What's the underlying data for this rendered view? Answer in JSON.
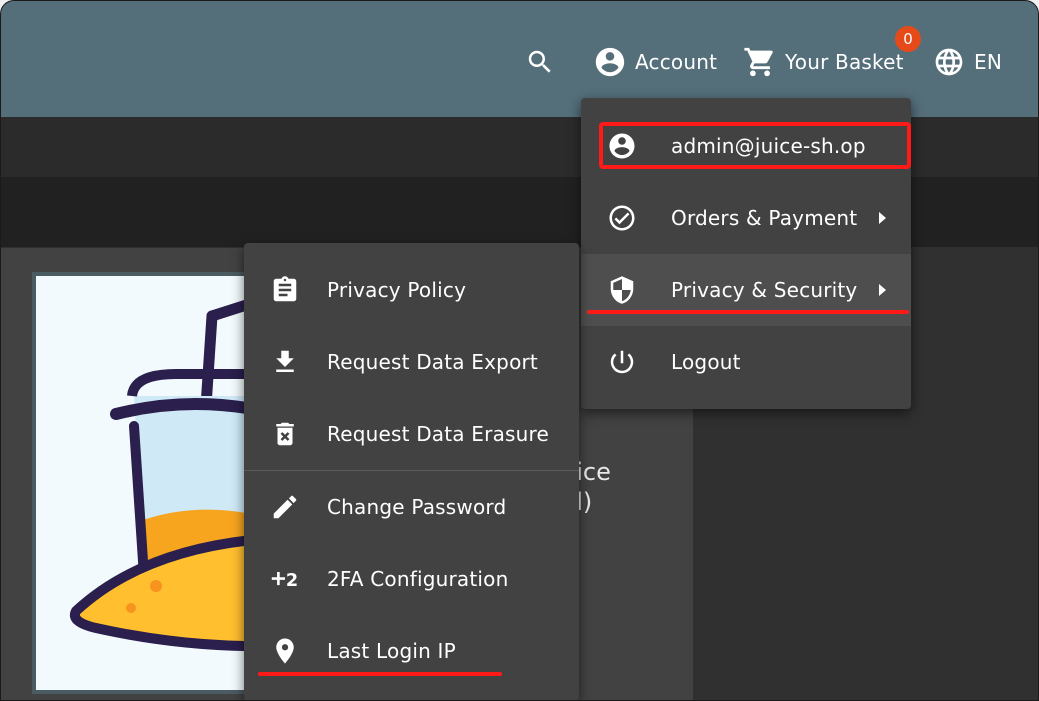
{
  "toolbar": {
    "account_label": "Account",
    "basket_label": "Your Basket",
    "basket_count": "0",
    "language_label": "EN"
  },
  "product": {
    "name_fragment_1": "uice",
    "name_fragment_2": "nl)"
  },
  "account_menu": {
    "items": [
      {
        "label": "admin@juice-sh.op",
        "icon": "account-circle-icon"
      },
      {
        "label": "Orders & Payment",
        "icon": "check-circle-icon"
      },
      {
        "label": "Privacy & Security",
        "icon": "shield-icon"
      },
      {
        "label": "Logout",
        "icon": "power-icon"
      }
    ]
  },
  "privacy_menu": {
    "items": [
      {
        "label": "Privacy Policy",
        "icon": "clipboard-icon"
      },
      {
        "label": "Request Data Export",
        "icon": "download-icon"
      },
      {
        "label": "Request Data Erasure",
        "icon": "delete-icon"
      },
      {
        "label": "Change Password",
        "icon": "pencil-icon"
      },
      {
        "label": "2FA Configuration",
        "icon": "plus-two-icon"
      },
      {
        "label": "Last Login IP",
        "icon": "location-pin-icon"
      }
    ]
  },
  "colors": {
    "toolbar": "#546e7a",
    "menu_bg": "#424242",
    "highlight": "#ff1a1a",
    "badge": "#e64a19"
  }
}
